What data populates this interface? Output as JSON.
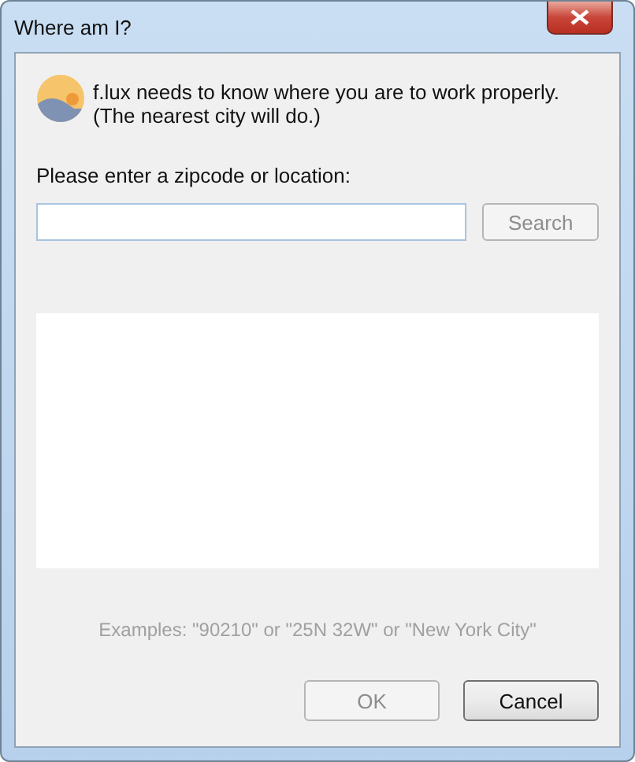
{
  "window": {
    "title": "Where am I?"
  },
  "message": {
    "lines": [
      "f.lux needs to know where you are to work properly.",
      "(The nearest city will do.)"
    ]
  },
  "location": {
    "label": "Please enter a zipcode or location:",
    "search_button": {
      "label": "Search",
      "disabled": true
    }
  },
  "examples": "Examples: \"90210\" or \"25N 32W\" or \"New York City\"",
  "buttons": [
    {
      "label": "OK",
      "disabled": true
    },
    {
      "label": "Cancel",
      "disabled": false
    }
  ]
}
